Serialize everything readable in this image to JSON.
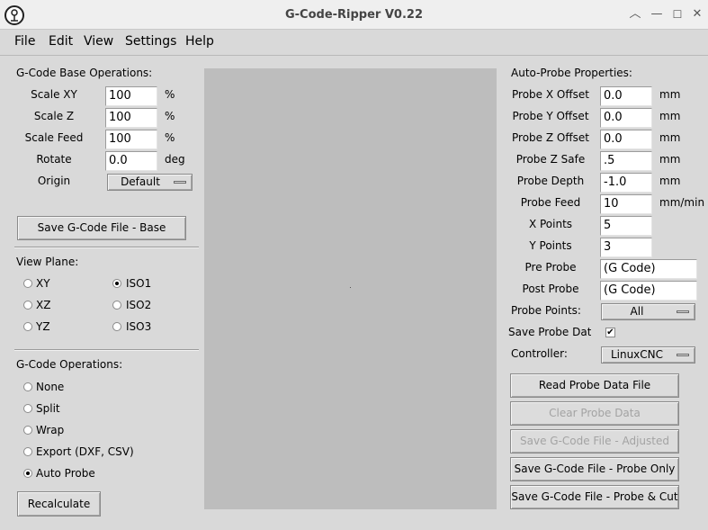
{
  "window": {
    "title": "G-Code-Ripper V0.22",
    "icon": "app-logo-icon",
    "controls": [
      "chevron-up-icon",
      "minimize-icon",
      "maximize-icon",
      "close-icon"
    ]
  },
  "menu": [
    "File",
    "Edit",
    "View",
    "Settings",
    "Help"
  ],
  "base_ops": {
    "title": "G-Code Base Operations:",
    "scale_xy": {
      "label": "Scale XY",
      "value": "100",
      "unit": "%"
    },
    "scale_z": {
      "label": "Scale Z",
      "value": "100",
      "unit": "%"
    },
    "scale_feed": {
      "label": "Scale Feed",
      "value": "100",
      "unit": "%"
    },
    "rotate": {
      "label": "Rotate",
      "value": "0.0",
      "unit": "deg"
    },
    "origin": {
      "label": "Origin",
      "value": "Default"
    },
    "save_button": "Save G-Code File - Base"
  },
  "view_plane": {
    "title": "View Plane:",
    "options": [
      "XY",
      "XZ",
      "YZ",
      "ISO1",
      "ISO2",
      "ISO3"
    ],
    "selected": "ISO1"
  },
  "gcode_ops": {
    "title": "G-Code Operations:",
    "options": [
      "None",
      "Split",
      "Wrap",
      "Export (DXF, CSV)",
      "Auto Probe"
    ],
    "selected": "Auto Probe",
    "recalculate_button": "Recalculate"
  },
  "probe": {
    "title": "Auto-Probe Properties:",
    "x_offset": {
      "label": "Probe X Offset",
      "value": "0.0",
      "unit": "mm"
    },
    "y_offset": {
      "label": "Probe Y Offset",
      "value": "0.0",
      "unit": "mm"
    },
    "z_offset": {
      "label": "Probe Z Offset",
      "value": "0.0",
      "unit": "mm"
    },
    "z_safe": {
      "label": "Probe Z Safe",
      "value": ".5",
      "unit": "mm"
    },
    "depth": {
      "label": "Probe Depth",
      "value": "-1.0",
      "unit": "mm"
    },
    "feed": {
      "label": "Probe Feed",
      "value": "10",
      "unit": "mm/min"
    },
    "x_points": {
      "label": "X Points",
      "value": "5"
    },
    "y_points": {
      "label": "Y Points",
      "value": "3"
    },
    "pre_probe": {
      "label": "Pre Probe",
      "value": "(G Code)"
    },
    "post_probe": {
      "label": "Post Probe",
      "value": "(G Code)"
    },
    "probe_points": {
      "label": "Probe Points:",
      "value": "All"
    },
    "save_probe_data": {
      "label": "Save Probe Data",
      "checked": true
    },
    "controller": {
      "label": "Controller:",
      "value": "LinuxCNC"
    },
    "buttons": {
      "read": "Read Probe Data File",
      "clear": "Clear Probe Data",
      "save_adjusted": "Save G-Code File - Adjusted",
      "save_probe_only": "Save G-Code File - Probe Only",
      "save_probe_cut": "Save G-Code File - Probe & Cut"
    }
  }
}
